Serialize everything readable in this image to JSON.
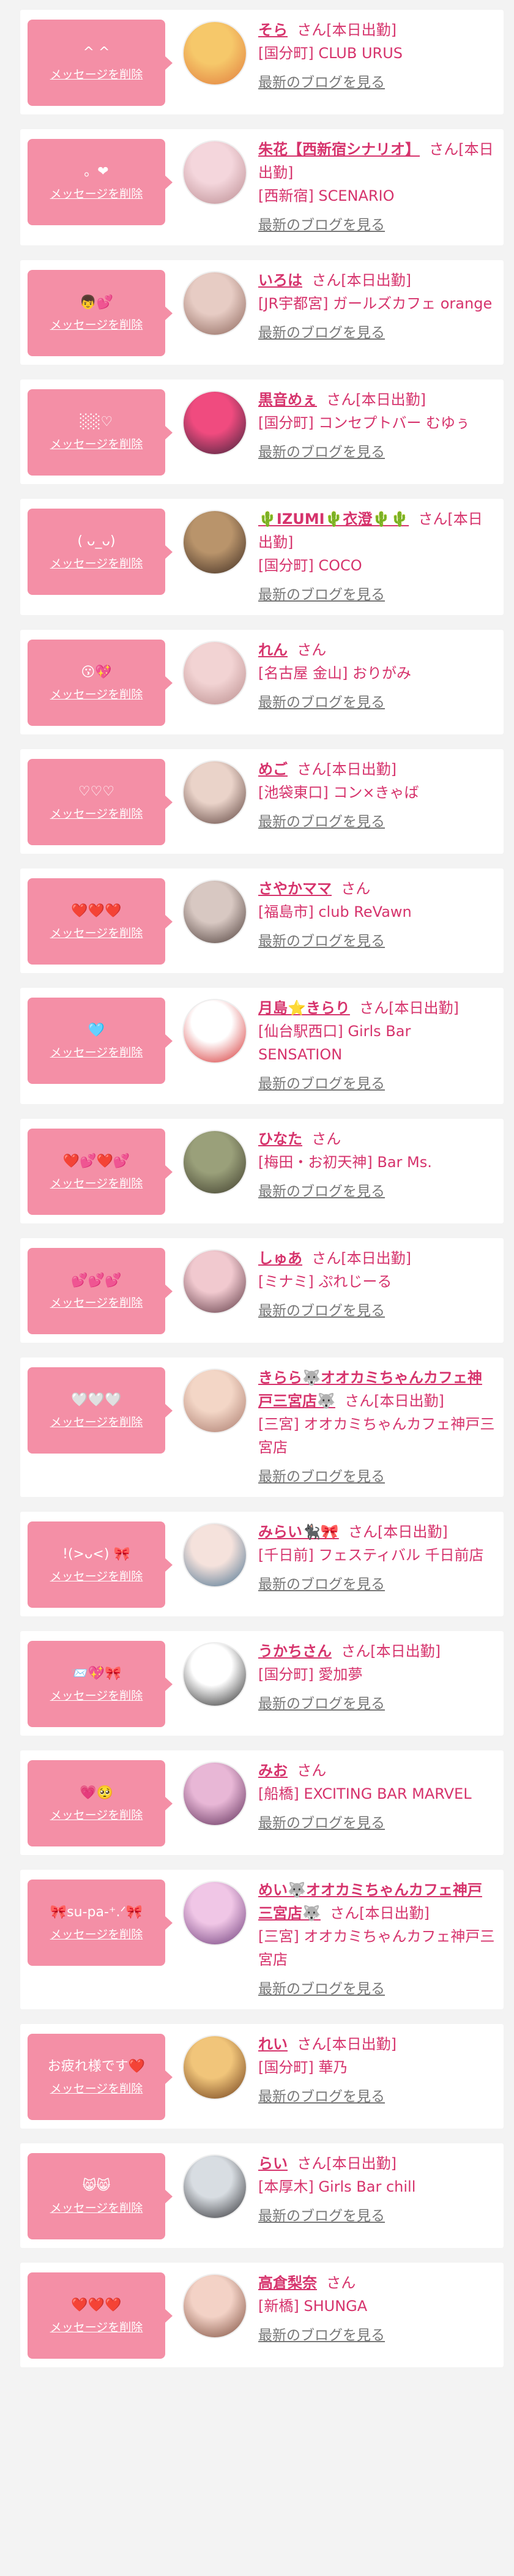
{
  "delete_label": "メッセージを削除",
  "blog_label": "最新のブログを見る",
  "colors": {
    "accent": "#d6336c",
    "bubble": "#f48fa6",
    "background": "#f3f3f3"
  },
  "cards": [
    {
      "message": "^ ^",
      "name": "そら",
      "suffix": "さん[本日出勤]",
      "shop": "[国分町] CLUB URUS",
      "avatar": [
        "#f6c86a",
        "#e07a3c"
      ]
    },
    {
      "message": "。❤︎",
      "name": "朱花【西新宿シナリオ】",
      "suffix": "さん[本日出勤]",
      "shop": "[西新宿] SCENARIO",
      "avatar": [
        "#f4d6dc",
        "#b98a8f"
      ]
    },
    {
      "message": "👦💕",
      "name": "いろは",
      "suffix": "さん[本日出勤]",
      "shop": "[JR宇都宮] ガールズカフェ orange",
      "avatar": [
        "#e7ccc4",
        "#8a6358"
      ]
    },
    {
      "message": "░░♡",
      "name": "黒音めぇ",
      "suffix": "さん[本日出勤]",
      "shop": "[国分町] コンセプトバー むゆぅ",
      "avatar": [
        "#f04b7f",
        "#3a2238"
      ]
    },
    {
      "message": "( ᴗ_ᴗ)",
      "name": "🌵IZUMI🌵衣澄🌵🌵",
      "suffix": "さん[本日出勤]",
      "shop": "[国分町] COCO",
      "avatar": [
        "#b9946b",
        "#3c2a20"
      ]
    },
    {
      "message": "😗💖",
      "name": "れん",
      "suffix": "さん",
      "shop": "[名古屋 金山] おりがみ",
      "avatar": [
        "#f2d3d3",
        "#b88b8b"
      ]
    },
    {
      "message": "♡♡♡",
      "name": "めご",
      "suffix": "さん[本日出勤]",
      "shop": "[池袋東口] コン×きゃば",
      "avatar": [
        "#ead3c9",
        "#5a3f3a"
      ]
    },
    {
      "message": "❤️❤️❤️",
      "name": "さやかママ",
      "suffix": "さん",
      "shop": "[福島市] club ReVawn",
      "avatar": [
        "#d8c8c2",
        "#4a3a36"
      ]
    },
    {
      "message": "🩵",
      "name": "月島⭐きらり",
      "suffix": "さん[本日出勤]",
      "shop": "[仙台駅西口] Girls Bar SENSATION",
      "avatar": [
        "#ffffff",
        "#d42a2a"
      ]
    },
    {
      "message": "❤️💕❤️💕",
      "name": "ひなた",
      "suffix": "さん",
      "shop": "[梅田・お初天神] Bar Ms.",
      "avatar": [
        "#9aa07a",
        "#3c3a2a"
      ]
    },
    {
      "message": "💕💕💕",
      "name": "しゅあ",
      "suffix": "さん[本日出勤]",
      "shop": "[ミナミ] ぷれじーる",
      "avatar": [
        "#f1c9cf",
        "#5a3540"
      ]
    },
    {
      "message": "🤍🤍🤍",
      "name": "きらら🐺オオカミちゃんカフェ神戸三宮店🐺",
      "suffix": "さん[本日出勤]",
      "shop": "[三宮] オオカミちゃんカフェ神戸三宮店",
      "avatar": [
        "#f3d6c6",
        "#a7776a"
      ]
    },
    {
      "message": "!(>ᴗ<) 🎀",
      "name": "みらい🐈‍⬛🎀",
      "suffix": "さん[本日出勤]",
      "shop": "[千日前] フェスティバル 千日前店",
      "avatar": [
        "#f5e2dc",
        "#47708f"
      ]
    },
    {
      "message": "📨💖🎀",
      "name": "うかちさん",
      "suffix": "さん[本日出勤]",
      "shop": "[国分町] 愛加夢",
      "avatar": [
        "#ffffff",
        "#222222"
      ]
    },
    {
      "message": "💗🥺",
      "name": "みお",
      "suffix": "さん",
      "shop": "[船橋] EXCITING BAR MARVEL",
      "avatar": [
        "#e8b7d6",
        "#5a2a55"
      ]
    },
    {
      "message": "🎀su-pa-⁺.ᐟ🎀",
      "name": "めい🐺オオカミちゃんカフェ神戸三宮店🐺",
      "suffix": "さん[本日出勤]",
      "shop": "[三宮] オオカミちゃんカフェ神戸三宮店",
      "avatar": [
        "#f0c6e6",
        "#6b3a78"
      ]
    },
    {
      "message": "お疲れ様です❤️",
      "name": "れい",
      "suffix": "さん[本日出勤]",
      "shop": "[国分町] 華乃",
      "avatar": [
        "#f1c57a",
        "#6b3a18"
      ]
    },
    {
      "message": "😸😸",
      "name": "らい",
      "suffix": "さん[本日出勤]",
      "shop": "[本厚木] Girls Bar chill",
      "avatar": [
        "#d8dde2",
        "#2c2c30"
      ]
    },
    {
      "message": "❤️❤️❤️",
      "name": "高倉梨奈",
      "suffix": "さん",
      "shop": "[新橋] SHUNGA",
      "avatar": [
        "#f3d2c6",
        "#7a4a3a"
      ]
    }
  ]
}
